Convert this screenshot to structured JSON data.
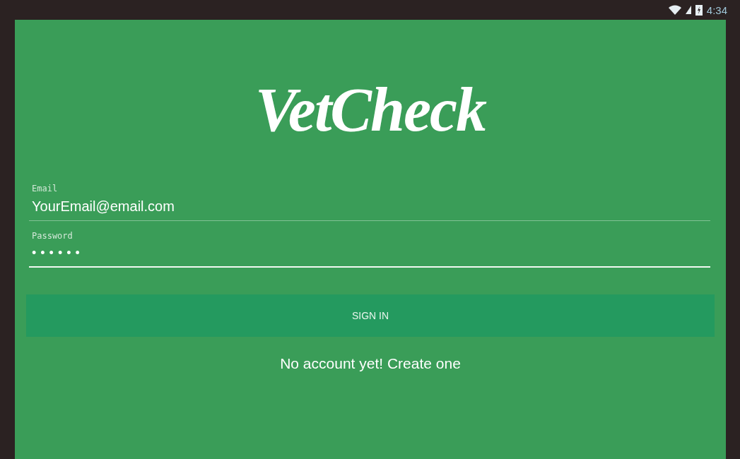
{
  "status_bar": {
    "time": "4:34"
  },
  "logo": "VetCheck",
  "fields": [
    {
      "label": "Email",
      "value": "YourEmail@email.com",
      "focused": false
    },
    {
      "label": "Password",
      "value": "••••••",
      "focused": true
    }
  ],
  "sign_in_button": "SIGN IN",
  "create_account_link": "No account yet! Create one"
}
